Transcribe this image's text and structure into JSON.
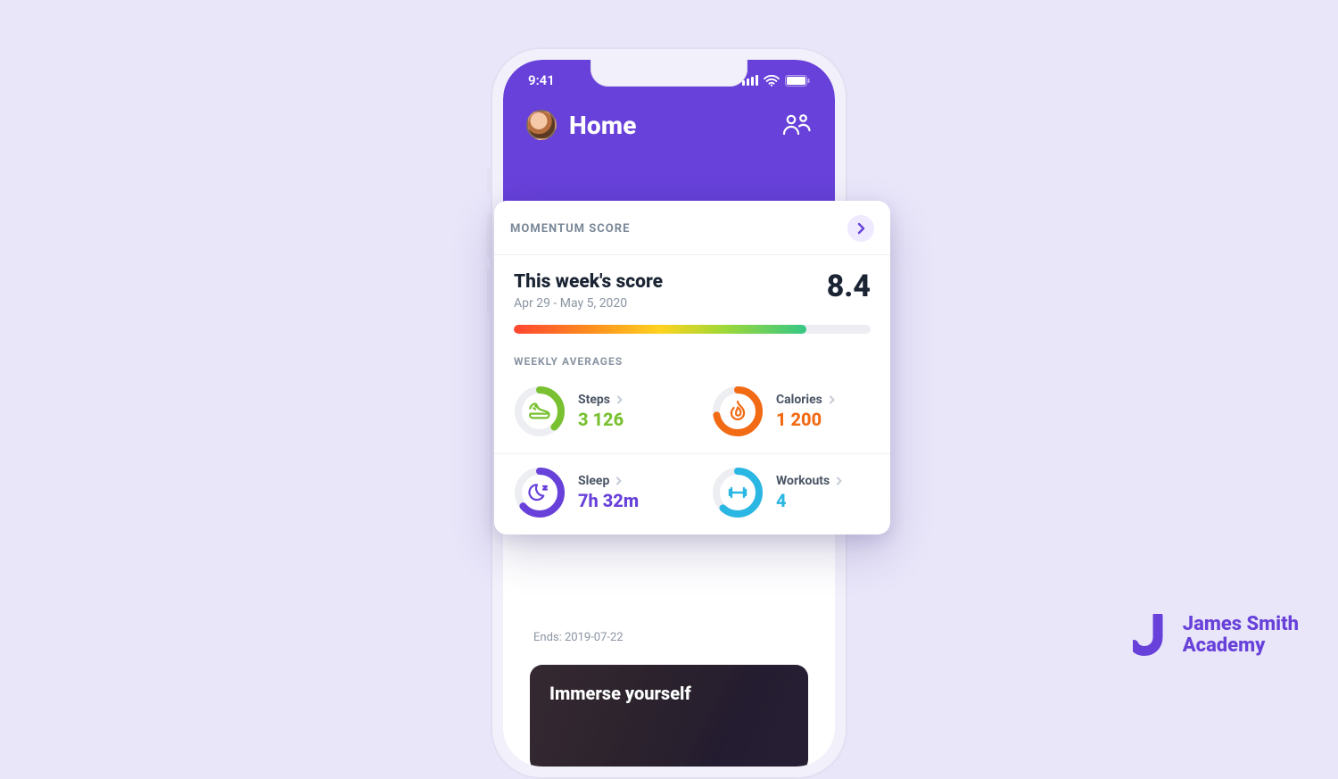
{
  "statusbar": {
    "time": "9:41"
  },
  "header": {
    "title": "Home"
  },
  "card": {
    "heading": "MOMENTUM SCORE",
    "title": "This week's score",
    "date_range": "Apr 29 - May 5, 2020",
    "score": "8.4",
    "progress_pct": 82,
    "weekly_label": "WEEKLY AVERAGES",
    "tiles": {
      "steps": {
        "label": "Steps",
        "value": "3 126",
        "pct": 38,
        "color": "#79c131"
      },
      "calories": {
        "label": "Calories",
        "value": "1 200",
        "pct": 72,
        "color": "#f26a13"
      },
      "sleep": {
        "label": "Sleep",
        "value": "7h 32m",
        "pct": 64,
        "color": "#6741d9"
      },
      "workouts": {
        "label": "Workouts",
        "value": "4",
        "pct": 62,
        "color": "#2bb7e3"
      }
    }
  },
  "below": {
    "ends": "Ends: 2019-07-22",
    "promo_title": "Immerse yourself"
  },
  "brand": {
    "line1": "James Smith",
    "line2": "Academy"
  },
  "colors": {
    "accent": "#6741d9",
    "bg": "#e9e6fa"
  }
}
